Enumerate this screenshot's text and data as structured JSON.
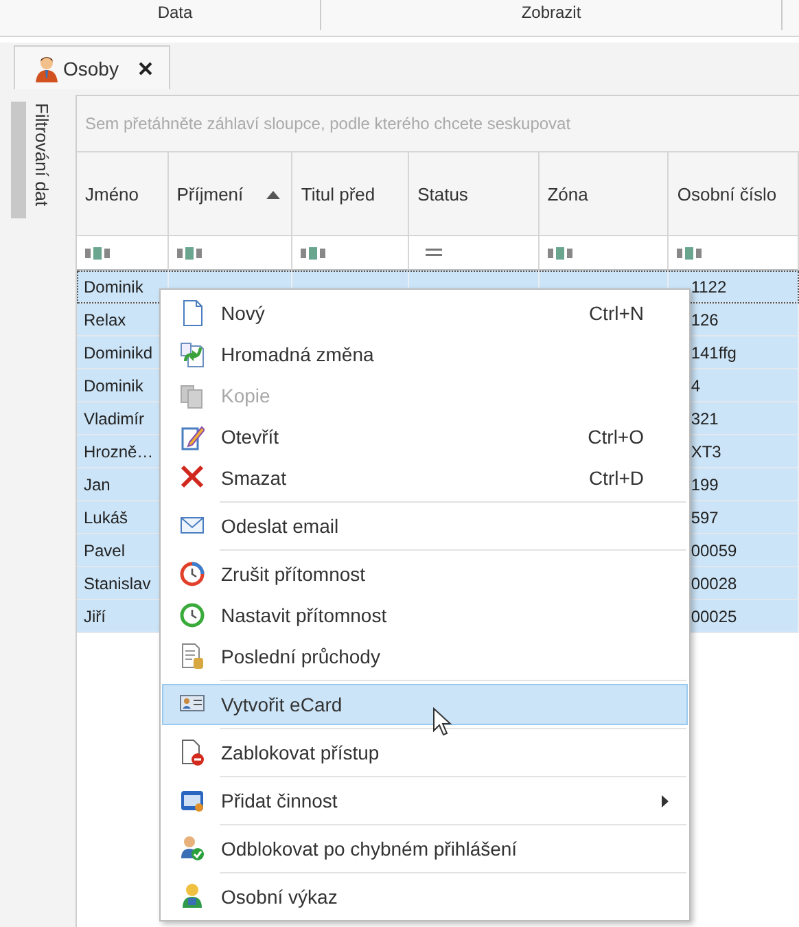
{
  "ribbon_groups": [
    "Data",
    "Zobrazit"
  ],
  "tabs": [
    {
      "label": "Osoby",
      "selected": true,
      "closable": true
    }
  ],
  "side_panel": {
    "label": "Filtrování dat"
  },
  "grid": {
    "group_panel_hint": "Sem přetáhněte záhlaví sloupce, podle kterého chcete seskupovat",
    "columns": [
      {
        "label": "Jméno",
        "sorted": false,
        "kind": "text"
      },
      {
        "label": "Příjmení",
        "sorted": true,
        "kind": "text"
      },
      {
        "label": "Titul před",
        "sorted": false,
        "kind": "text"
      },
      {
        "label": "Status",
        "sorted": false,
        "kind": "equals"
      },
      {
        "label": "Zóna",
        "sorted": false,
        "kind": "text"
      },
      {
        "label": "Osobní číslo",
        "sorted": false,
        "kind": "text"
      }
    ],
    "rows": [
      {
        "jmeno": "Dominik",
        "osobni_cislo": "1122",
        "selected": true,
        "focused": true
      },
      {
        "jmeno": "Relax",
        "osobni_cislo": "126",
        "selected": true,
        "focused": false
      },
      {
        "jmeno": "Dominikd",
        "osobni_cislo": "141ffg",
        "selected": true,
        "focused": false
      },
      {
        "jmeno": "Dominik",
        "osobni_cislo": "4",
        "selected": true,
        "focused": false
      },
      {
        "jmeno": "Vladimír",
        "osobni_cislo": "321",
        "selected": true,
        "focused": false
      },
      {
        "jmeno": "Hrozně…",
        "osobni_cislo": "XT3",
        "selected": true,
        "focused": false
      },
      {
        "jmeno": "Jan",
        "osobni_cislo": "199",
        "selected": true,
        "focused": false
      },
      {
        "jmeno": "Lukáš",
        "osobni_cislo": "597",
        "selected": true,
        "focused": false
      },
      {
        "jmeno": "Pavel",
        "osobni_cislo": "00059",
        "selected": true,
        "focused": false
      },
      {
        "jmeno": "Stanislav",
        "osobni_cislo": "00028",
        "selected": true,
        "focused": false
      },
      {
        "jmeno": "Jiří",
        "osobni_cislo": "00025",
        "selected": true,
        "focused": false
      }
    ]
  },
  "context_menu": {
    "items": [
      {
        "kind": "item",
        "label": "Nový",
        "shortcut": "Ctrl+N",
        "disabled": false,
        "selected": false,
        "submenu": false
      },
      {
        "kind": "item",
        "label": "Hromadná změna",
        "disabled": false,
        "selected": false,
        "submenu": false
      },
      {
        "kind": "item",
        "label": "Kopie",
        "disabled": true,
        "selected": false,
        "submenu": false
      },
      {
        "kind": "item",
        "label": "Otevřít",
        "shortcut": "Ctrl+O",
        "disabled": false,
        "selected": false,
        "submenu": false
      },
      {
        "kind": "item",
        "label": "Smazat",
        "shortcut": "Ctrl+D",
        "disabled": false,
        "selected": false,
        "submenu": false
      },
      {
        "kind": "separator"
      },
      {
        "kind": "item",
        "label": "Odeslat email",
        "disabled": false,
        "selected": false,
        "submenu": false
      },
      {
        "kind": "separator"
      },
      {
        "kind": "item",
        "label": "Zrušit přítomnost",
        "disabled": false,
        "selected": false,
        "submenu": false
      },
      {
        "kind": "item",
        "label": "Nastavit přítomnost",
        "disabled": false,
        "selected": false,
        "submenu": false
      },
      {
        "kind": "item",
        "label": "Poslední průchody",
        "disabled": false,
        "selected": false,
        "submenu": false
      },
      {
        "kind": "separator"
      },
      {
        "kind": "item",
        "label": "Vytvořit eCard",
        "disabled": false,
        "selected": true,
        "submenu": false
      },
      {
        "kind": "separator"
      },
      {
        "kind": "item",
        "label": "Zablokovat přístup",
        "disabled": false,
        "selected": false,
        "submenu": false
      },
      {
        "kind": "separator"
      },
      {
        "kind": "item",
        "label": "Přidat činnost",
        "disabled": false,
        "selected": false,
        "submenu": true
      },
      {
        "kind": "separator"
      },
      {
        "kind": "item",
        "label": "Odblokovat po chybném přihlášení",
        "disabled": false,
        "selected": false,
        "submenu": false
      },
      {
        "kind": "separator"
      },
      {
        "kind": "item",
        "label": "Osobní výkaz",
        "disabled": false,
        "selected": false,
        "submenu": false
      }
    ]
  }
}
